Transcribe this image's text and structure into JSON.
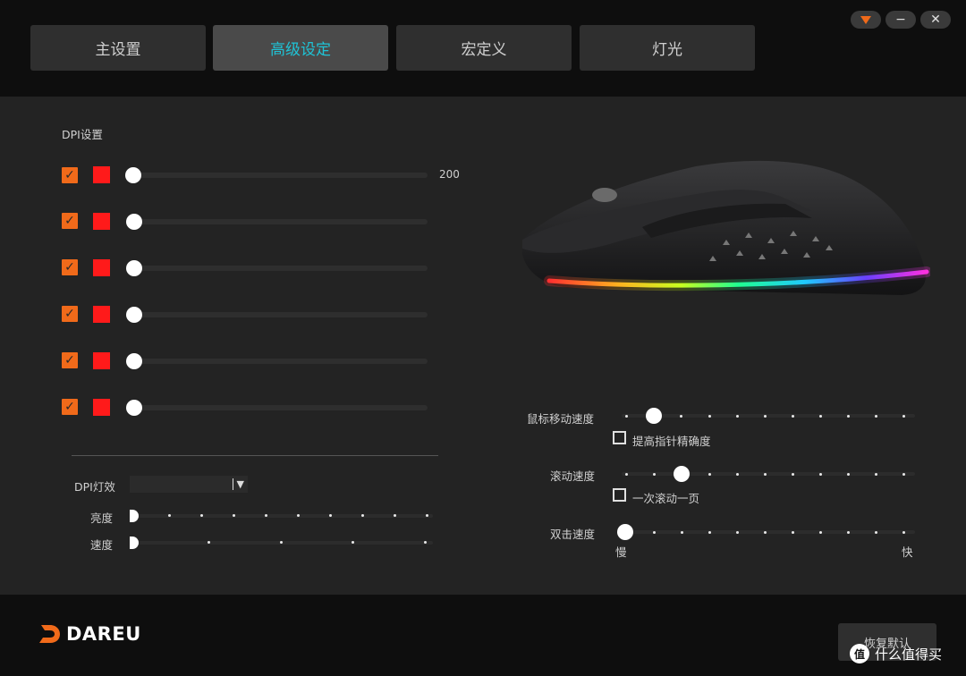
{
  "window": {
    "tabs": [
      {
        "label": "主设置",
        "active": false
      },
      {
        "label": "高级设定",
        "active": true
      },
      {
        "label": "宏定义",
        "active": false
      },
      {
        "label": "灯光",
        "active": false
      }
    ],
    "controls": {
      "menu_icon": "triangle-down-icon",
      "minimize": "−",
      "close": "✕"
    },
    "accent_color": "#1fc3d6",
    "brand_color": "#f06a1a"
  },
  "dpi": {
    "title": "DPI设置",
    "rows": [
      {
        "checked": true,
        "color": "#ff1a1a",
        "value_label": "200"
      },
      {
        "checked": true,
        "color": "#ff1a1a",
        "value_label": ""
      },
      {
        "checked": true,
        "color": "#ff1a1a",
        "value_label": ""
      },
      {
        "checked": true,
        "color": "#ff1a1a",
        "value_label": ""
      },
      {
        "checked": true,
        "color": "#ff1a1a",
        "value_label": ""
      },
      {
        "checked": true,
        "color": "#ff1a1a",
        "value_label": ""
      }
    ],
    "light_effect_label": "DPI灯效",
    "light_effect_value": "",
    "brightness_label": "亮度",
    "speed_label": "速度"
  },
  "mouse_settings": {
    "pointer_speed_label": "鼠标移动速度",
    "enhance_precision_label": "提高指针精确度",
    "scroll_speed_label": "滚动速度",
    "scroll_one_page_label": "一次滚动一页",
    "double_click_label": "双击速度",
    "slow_label": "慢",
    "fast_label": "快"
  },
  "footer": {
    "brand": "DAREU",
    "reset_label": "恢复默认"
  },
  "watermark": {
    "icon": "值",
    "text": "什么值得买"
  }
}
